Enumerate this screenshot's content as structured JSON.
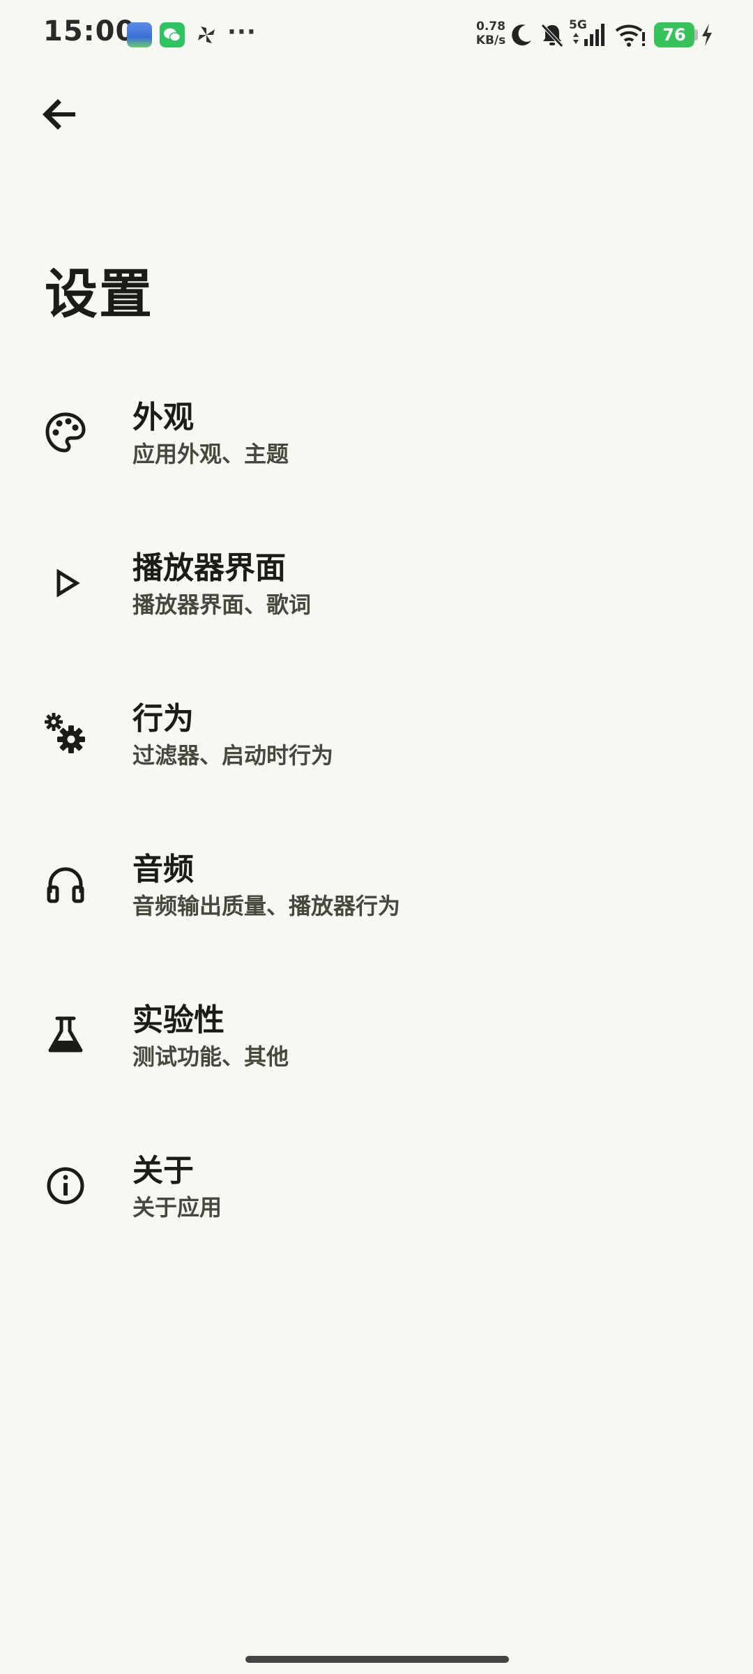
{
  "status_bar": {
    "time": "15:00",
    "more": "···",
    "net_speed_value": "0.78",
    "net_speed_unit": "KB/s",
    "network_type": "5G",
    "battery_level": "76",
    "icons": [
      "gallery-app-icon",
      "wechat-icon",
      "pinwheel-icon",
      "moon-icon",
      "bell-off-icon",
      "signal-icon",
      "wifi-icon",
      "battery-icon",
      "charging-icon"
    ]
  },
  "header": {
    "back_icon": "arrow-left-icon",
    "title": "设置"
  },
  "settings": {
    "items": [
      {
        "title": "外观",
        "subtitle": "应用外观、主题",
        "icon": "palette-icon"
      },
      {
        "title": "播放器界面",
        "subtitle": "播放器界面、歌词",
        "icon": "play-outline-icon"
      },
      {
        "title": "行为",
        "subtitle": "过滤器、启动时行为",
        "icon": "gears-icon"
      },
      {
        "title": "音频",
        "subtitle": "音频输出质量、播放器行为",
        "icon": "headphones-icon"
      },
      {
        "title": "实验性",
        "subtitle": "测试功能、其他",
        "icon": "flask-icon"
      },
      {
        "title": "关于",
        "subtitle": "关于应用",
        "icon": "info-icon"
      }
    ]
  },
  "colors": {
    "background": "#f7f8f1",
    "text_primary": "#1b1c18",
    "text_secondary": "#44483f",
    "battery": "#36c35a"
  }
}
